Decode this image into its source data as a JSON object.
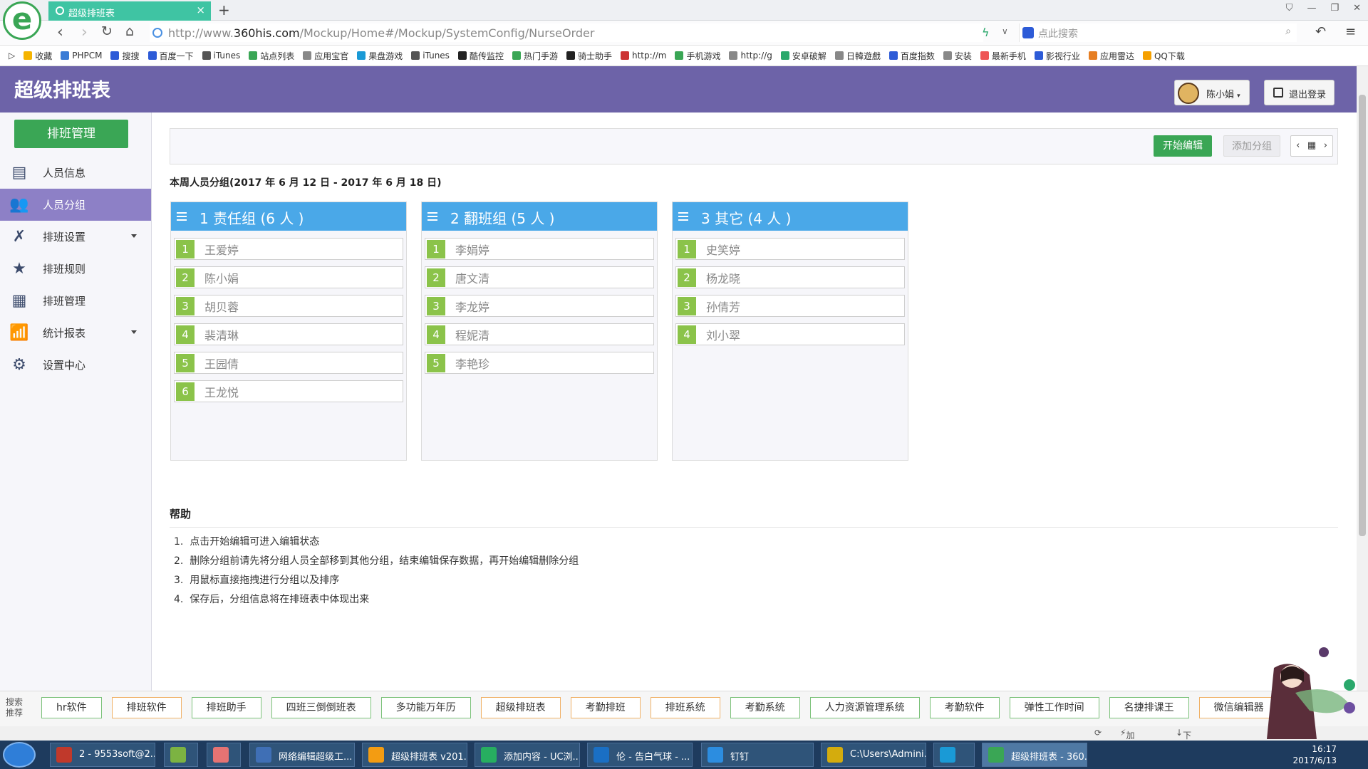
{
  "browser": {
    "logo_glyph": "e",
    "tab_title": "超级排班表",
    "new_tab": "+",
    "url_prefix": "http://www.",
    "url_host": "360his.com",
    "url_path": "/Mockup/Home#/Mockup/SystemConfig/NurseOrder",
    "search_placeholder": "点此搜索",
    "bookmarks": [
      "收藏",
      "PHPCM",
      "搜搜",
      "百度一下",
      "iTunes",
      "站点列表",
      "应用宝官",
      "果盘游戏",
      "iTunes",
      "酷传监控",
      "热门手游",
      "骑士助手",
      "http://m",
      "手机游戏",
      "http://g",
      "安卓破解",
      "日韓遊戲",
      "百度指数",
      "安装",
      "最新手机",
      "影视行业",
      "应用雷达",
      "QQ下载"
    ]
  },
  "header": {
    "app_title": "超级排班表",
    "user_name": "陈小娟",
    "logout_label": "退出登录"
  },
  "sidebar": {
    "head_button": "排班管理",
    "items": [
      {
        "label": "人员信息",
        "icon": "id-card-icon"
      },
      {
        "label": "人员分组",
        "icon": "users-icon"
      },
      {
        "label": "排班设置",
        "icon": "wrench-icon"
      },
      {
        "label": "排班规则",
        "icon": "star-icon"
      },
      {
        "label": "排班管理",
        "icon": "calendar-icon"
      },
      {
        "label": "统计报表",
        "icon": "chart-icon"
      },
      {
        "label": "设置中心",
        "icon": "gear-icon"
      }
    ]
  },
  "toolbar": {
    "start_edit": "开始编辑",
    "add_group": "添加分组",
    "prev": "‹",
    "next": "›"
  },
  "week_title": "本周人员分组(2017 年 6 月 12 日 - 2017 年 6 月 18 日)",
  "groups": [
    {
      "title": "1 责任组 (6 人 )",
      "members": [
        "王爱婷",
        "陈小娟",
        "胡贝蓉",
        "裴清琳",
        "王园倩",
        "王龙悦"
      ]
    },
    {
      "title": "2 翻班组 (5 人 )",
      "members": [
        "李娟婷",
        "唐文清",
        "李龙婷",
        "程妮清",
        "李艳珍"
      ]
    },
    {
      "title": "3 其它 (4 人 )",
      "members": [
        "史笑婷",
        "杨龙晓",
        "孙倩芳",
        "刘小翠"
      ]
    }
  ],
  "help": {
    "title": "帮助",
    "items": [
      "点击开始编辑可进入编辑状态",
      "删除分组前请先将分组人员全部移到其他分组，结束编辑保存数据，再开始编辑删除分组",
      "用鼠标直接拖拽进行分组以及排序",
      "保存后，分组信息将在排班表中体现出来"
    ]
  },
  "bottom": {
    "search_label": "搜索推荐",
    "chips": [
      "hr软件",
      "排班软件",
      "排班助手",
      "四班三倒倒班表",
      "多功能万年历",
      "超级排班表",
      "考勤排班",
      "排班系统",
      "考勤系统",
      "人力资源管理系统",
      "考勤软件",
      "弹性工作时间",
      "名捷排课王",
      "微信编辑器"
    ],
    "accelerator": "加速器",
    "download": "下载"
  },
  "taskbar": {
    "tasks": [
      "2 - 9553soft@2...",
      "",
      "",
      "网络编辑超级工...",
      "超级排班表 v201...",
      "添加内容 - UC浏...",
      "伦 - 告白气球 - ...",
      "钉钉",
      "C:\\Users\\Admini...",
      "",
      "超级排班表 - 360..."
    ],
    "time": "16:17",
    "date": "2017/6/13"
  }
}
